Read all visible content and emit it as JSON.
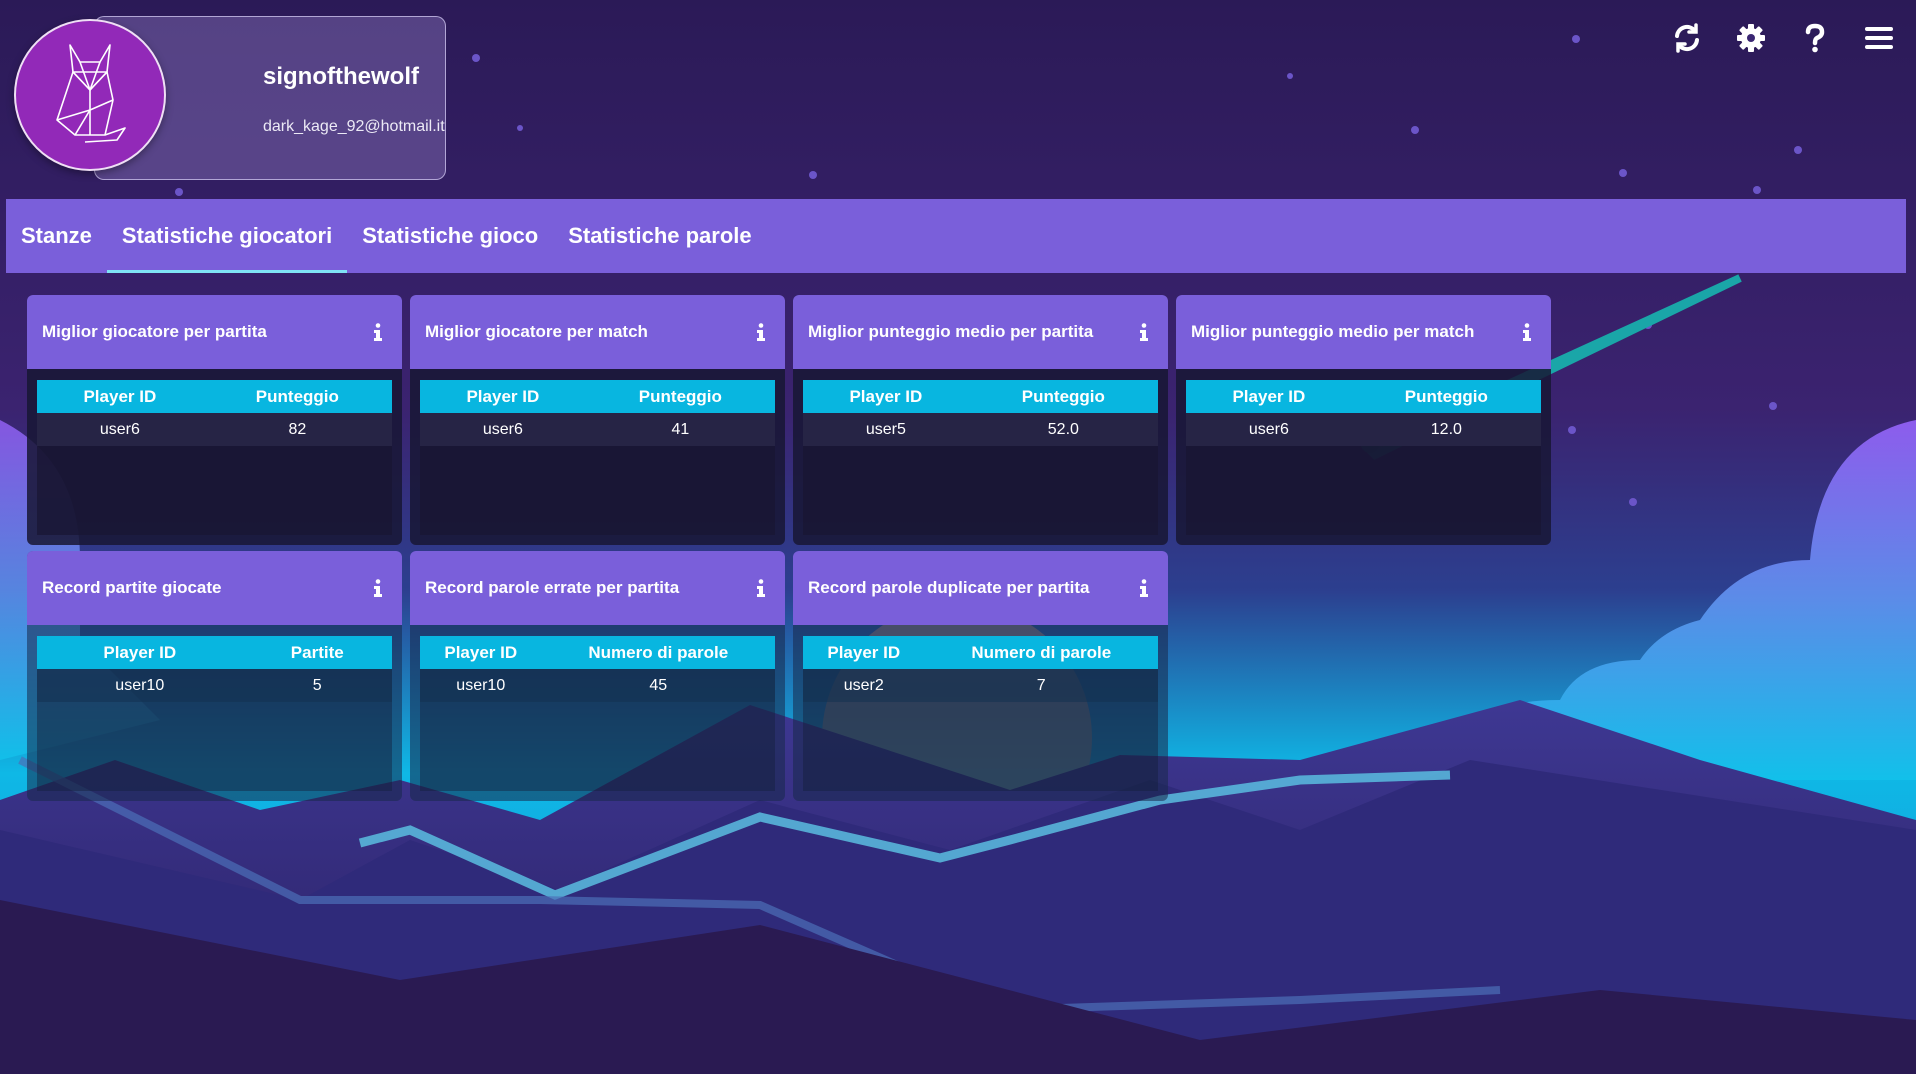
{
  "profile": {
    "username": "signofthewolf",
    "email": "dark_kage_92@hotmail.it"
  },
  "header_icons": [
    "refresh-icon",
    "gear-icon",
    "question-icon",
    "menu-icon"
  ],
  "tabs": [
    {
      "label": "Stanze",
      "active": false
    },
    {
      "label": "Statistiche giocatori",
      "active": true
    },
    {
      "label": "Statistiche gioco",
      "active": false
    },
    {
      "label": "Statistiche parole",
      "active": false
    }
  ],
  "cards": [
    {
      "title": "Miglior giocatore per partita",
      "col1": "Player ID",
      "col2": "Punteggio",
      "rows": [
        [
          "user6",
          "82"
        ]
      ]
    },
    {
      "title": "Miglior giocatore per match",
      "col1": "Player ID",
      "col2": "Punteggio",
      "rows": [
        [
          "user6",
          "41"
        ]
      ]
    },
    {
      "title": "Miglior punteggio medio per partita",
      "col1": "Player ID",
      "col2": "Punteggio",
      "rows": [
        [
          "user5",
          "52.0"
        ]
      ]
    },
    {
      "title": "Miglior punteggio medio per match",
      "col1": "Player ID",
      "col2": "Punteggio",
      "rows": [
        [
          "user6",
          "12.0"
        ]
      ]
    },
    {
      "title": "Record partite giocate",
      "col1": "Player ID",
      "col2": "Partite",
      "rows": [
        [
          "user10",
          "5"
        ]
      ]
    },
    {
      "title": "Record parole errate per partita",
      "col1": "Player ID",
      "col2": "Numero di parole",
      "rows": [
        [
          "user10",
          "45"
        ]
      ]
    },
    {
      "title": "Record parole duplicate per partita",
      "col1": "Player ID",
      "col2": "Numero di parole",
      "rows": [
        [
          "user2",
          "7"
        ]
      ]
    }
  ],
  "colors": {
    "tab_bar": "#7a5fda",
    "table_header": "#08b6e0",
    "active_tab_underline": "#7fe3f5",
    "avatar": "#9229b8"
  }
}
